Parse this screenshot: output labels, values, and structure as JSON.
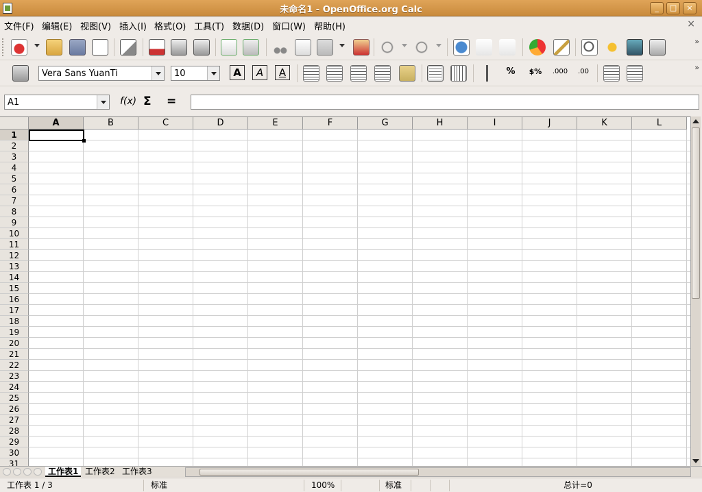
{
  "window": {
    "title": "未命名1 - OpenOffice.org Calc",
    "buttons": [
      "_",
      "□",
      "×"
    ]
  },
  "menu": {
    "items": [
      "文件(F)",
      "编辑(E)",
      "视图(V)",
      "插入(I)",
      "格式(O)",
      "工具(T)",
      "数据(D)",
      "窗口(W)",
      "帮助(H)"
    ],
    "close_doc": "×"
  },
  "format": {
    "font_name": "Vera Sans YuanTi",
    "font_size": "10",
    "bold": "A",
    "italic": "A",
    "underline": "A",
    "percent": "%",
    "currency": "$%",
    "add_decimal": ".000",
    "del_decimal": ".00"
  },
  "formula_bar": {
    "name_box": "A1",
    "function_wizard": "f(x)",
    "sum": "Σ",
    "equals": "=",
    "content": ""
  },
  "sheet": {
    "columns": [
      "A",
      "B",
      "C",
      "D",
      "E",
      "F",
      "G",
      "H",
      "I",
      "J",
      "K",
      "L"
    ],
    "rows": [
      "1",
      "2",
      "3",
      "4",
      "5",
      "6",
      "7",
      "8",
      "9",
      "10",
      "11",
      "12",
      "13",
      "14",
      "15",
      "16",
      "17",
      "18",
      "19",
      "20",
      "21",
      "22",
      "23",
      "24",
      "25",
      "26",
      "27",
      "28",
      "29",
      "30",
      "31"
    ],
    "active_cell": "A1"
  },
  "tabs": [
    "工作表1",
    "工作表2",
    "工作表3"
  ],
  "status": {
    "sheet": "工作表 1 / 3",
    "style": "标准",
    "zoom": "100%",
    "mode": "标准",
    "sum": "总计=0"
  },
  "colors": {
    "title_bar": "#d0923f",
    "chrome": "#efebe7",
    "grid_line": "#cfcfcf"
  }
}
